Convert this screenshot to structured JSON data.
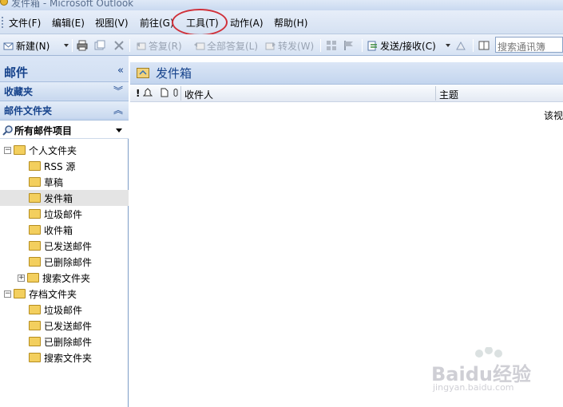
{
  "window": {
    "title": "发件箱 - Microsoft Outlook"
  },
  "menubar": {
    "items": [
      "文件(F)",
      "编辑(E)",
      "视图(V)",
      "前往(G)",
      "工具(T)",
      "动作(A)",
      "帮助(H)"
    ]
  },
  "toolbar": {
    "new_label": "新建(N)",
    "reply_label": "答复(R)",
    "reply_all_label": "全部答复(L)",
    "forward_label": "转发(W)",
    "send_receive_label": "发送/接收(C)",
    "search_placeholder": "搜索通讯簿"
  },
  "nav": {
    "header": "邮件",
    "favorites": "收藏夹",
    "mail_folders": "邮件文件夹",
    "all_mail": "所有邮件项目",
    "tree": [
      {
        "label": "个人文件夹",
        "level": 0,
        "expander": "−"
      },
      {
        "label": "RSS 源",
        "level": 1
      },
      {
        "label": "草稿",
        "level": 1
      },
      {
        "label": "发件箱",
        "level": 1,
        "selected": true
      },
      {
        "label": "垃圾邮件",
        "level": 1
      },
      {
        "label": "收件箱",
        "level": 1
      },
      {
        "label": "已发送邮件",
        "level": 1
      },
      {
        "label": "已删除邮件",
        "level": 1
      },
      {
        "label": "搜索文件夹",
        "level": 1,
        "expander": "+"
      },
      {
        "label": "存档文件夹",
        "level": 0,
        "expander": "−"
      },
      {
        "label": "垃圾邮件",
        "level": 1
      },
      {
        "label": "已发送邮件",
        "level": 1
      },
      {
        "label": "已删除邮件",
        "level": 1
      },
      {
        "label": "搜索文件夹",
        "level": 1
      }
    ]
  },
  "main": {
    "title": "发件箱",
    "columns": {
      "to": "收件人",
      "subject": "主题"
    },
    "empty_text": "该视"
  },
  "watermark": {
    "brand": "Baidu经验",
    "url": "jingyan.baidu.com"
  },
  "colors": {
    "accent": "#15428b",
    "highlight_circle": "#d0313a"
  }
}
